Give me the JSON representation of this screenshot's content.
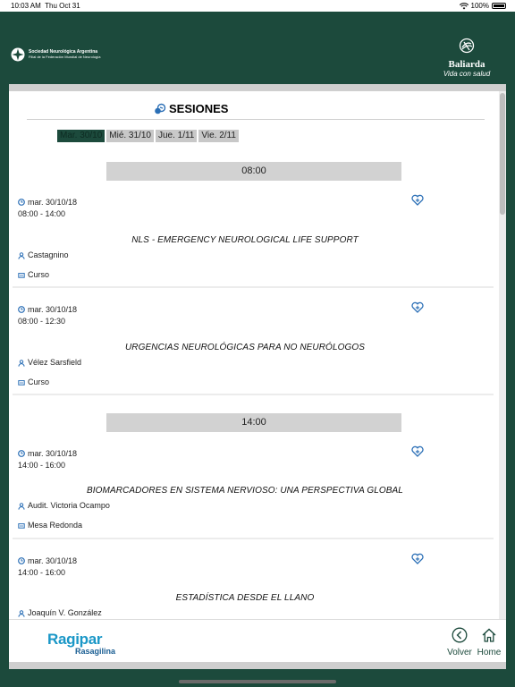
{
  "status_bar": {
    "time": "10:03 AM",
    "date": "Thu Oct 31",
    "battery": "100%"
  },
  "header": {
    "org_name": "Sociedad Neurológica Argentina",
    "org_sub": "Filial de la Federación Mundial de Neurología",
    "sponsor_name": "Baliarda",
    "sponsor_tagline": "Vida con salud"
  },
  "page": {
    "title": "SESIONES"
  },
  "day_tabs": [
    {
      "label": "Mar. 30/10",
      "active": true
    },
    {
      "label": "Mié. 31/10",
      "active": false
    },
    {
      "label": "Jue. 1/11",
      "active": false
    },
    {
      "label": "Vie. 2/11",
      "active": false
    }
  ],
  "time_groups": [
    "08:00",
    "14:00"
  ],
  "sessions": [
    {
      "date": "mar. 30/10/18",
      "time": "08:00 - 14:00",
      "title": "NLS - EMERGENCY NEUROLOGICAL LIFE SUPPORT",
      "room": "Castagnino",
      "type": "Curso"
    },
    {
      "date": "mar. 30/10/18",
      "time": "08:00 - 12:30",
      "title": "URGENCIAS NEUROLÓGICAS PARA NO NEURÓLOGOS",
      "room": "Vélez Sarsfield",
      "type": "Curso"
    },
    {
      "date": "mar. 30/10/18",
      "time": "14:00 - 16:00",
      "title": "BIOMARCADORES EN SISTEMA NERVIOSO: UNA PERSPECTIVA GLOBAL",
      "room": "Audit. Victoria Ocampo",
      "type": "Mesa Redonda"
    },
    {
      "date": "mar. 30/10/18",
      "time": "14:00 - 16:00",
      "title": "ESTADÍSTICA DESDE EL LLANO",
      "room": "Joaquín V. González",
      "type": ""
    }
  ],
  "footer": {
    "brand": "Ragipar",
    "brand_sub": "Rasagilina",
    "back_label": "Volver",
    "home_label": "Home"
  },
  "colors": {
    "primary": "#1c4a3c",
    "brand_blue": "#1a97c7",
    "accent_icon": "#2b6fb6"
  },
  "icons": [
    "wifi-icon",
    "battery-icon",
    "sna-logo",
    "baliarda-logo",
    "sesiones-icon",
    "clock-icon",
    "person-icon",
    "tag-icon",
    "heart-add-icon",
    "back-icon",
    "home-icon"
  ]
}
